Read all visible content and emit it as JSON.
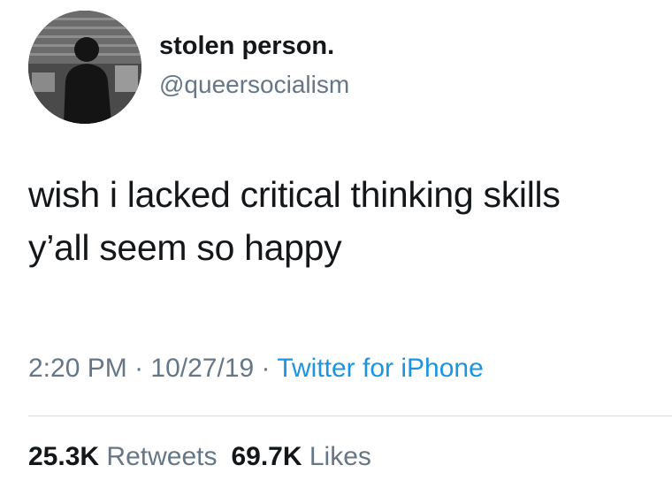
{
  "user": {
    "display_name": "stolen person.",
    "handle": "@queersocialism",
    "avatar": "avatar-silhouette-icon"
  },
  "tweet": {
    "lines": [
      "wish i lacked critical thinking skills",
      "y’all seem so happy"
    ]
  },
  "meta": {
    "time": "2:20 PM",
    "separator": " · ",
    "date": "10/27/19",
    "source": "Twitter for iPhone"
  },
  "stats": {
    "retweets_count": "25.3K",
    "retweets_label": "Retweets",
    "likes_count": "69.7K",
    "likes_label": "Likes"
  },
  "colors": {
    "text": "#14171a",
    "muted": "#657786",
    "link": "#1b95e0"
  }
}
